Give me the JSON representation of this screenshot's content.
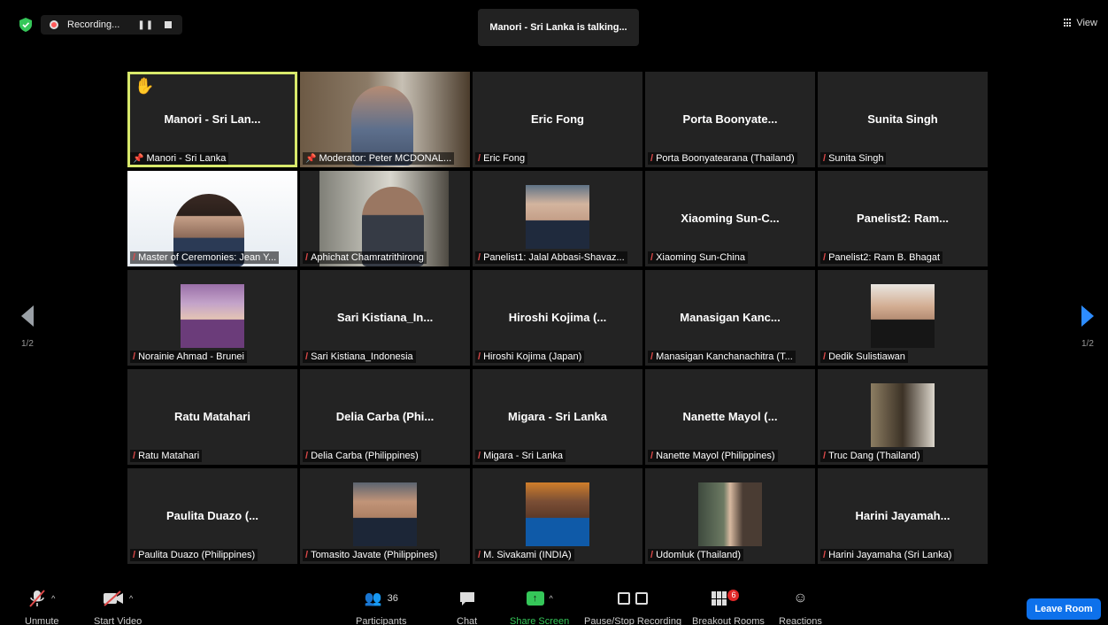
{
  "top": {
    "recording_label": "Recording...",
    "talking_banner": "Manori - Sri Lanka is talking...",
    "view_label": "View"
  },
  "nav": {
    "prev_page": "1/2",
    "next_page": "1/2"
  },
  "tiles": [
    {
      "big": "Manori - Sri Lan...",
      "label": "Manori - Sri Lanka",
      "icon": "pin-icon",
      "hand": "✋"
    },
    {
      "big": "",
      "label": "Moderator: Peter MCDONAL...",
      "icon": "pin-icon"
    },
    {
      "big": "Eric Fong",
      "label": "Eric Fong",
      "icon": "mic-muted-icon"
    },
    {
      "big": "Porta Boonyate...",
      "label": "Porta Boonyatearana (Thailand)",
      "icon": "mic-muted-icon"
    },
    {
      "big": "Sunita Singh",
      "label": "Sunita Singh",
      "icon": "mic-muted-icon"
    },
    {
      "big": "",
      "label": "Master of Ceremonies: Jean Y...",
      "icon": "mic-muted-icon"
    },
    {
      "big": "",
      "label": "Aphichat Chamratrithirong",
      "icon": "mic-muted-icon"
    },
    {
      "big": "",
      "label": "Panelist1: Jalal Abbasi-Shavaz...",
      "icon": "mic-muted-icon"
    },
    {
      "big": "Xiaoming Sun-C...",
      "label": "Xiaoming Sun-China",
      "icon": "mic-muted-icon"
    },
    {
      "big": "Panelist2: Ram...",
      "label": "Panelist2: Ram B. Bhagat",
      "icon": "mic-muted-icon"
    },
    {
      "big": "",
      "label": "Norainie Ahmad - Brunei",
      "icon": "mic-muted-icon"
    },
    {
      "big": "Sari Kistiana_In...",
      "label": "Sari Kistiana_Indonesia",
      "icon": "mic-muted-icon"
    },
    {
      "big": "Hiroshi Kojima (...",
      "label": "Hiroshi Kojima (Japan)",
      "icon": "mic-muted-icon"
    },
    {
      "big": "Manasigan Kanc...",
      "label": "Manasigan Kanchanachitra (T...",
      "icon": "mic-muted-icon"
    },
    {
      "big": "",
      "label": "Dedik Sulistiawan",
      "icon": "mic-muted-icon"
    },
    {
      "big": "Ratu Matahari",
      "label": "Ratu Matahari",
      "icon": "mic-muted-icon"
    },
    {
      "big": "Delia Carba (Phi...",
      "label": "Delia Carba (Philippines)",
      "icon": "mic-muted-icon"
    },
    {
      "big": "Migara - Sri Lanka",
      "label": "Migara - Sri Lanka",
      "icon": "mic-muted-icon"
    },
    {
      "big": "Nanette Mayol (...",
      "label": "Nanette Mayol (Philippines)",
      "icon": "mic-muted-icon"
    },
    {
      "big": "",
      "label": "Truc Dang (Thailand)",
      "icon": "mic-muted-icon"
    },
    {
      "big": "Paulita Duazo (...",
      "label": "Paulita Duazo (Philippines)",
      "icon": "mic-muted-icon"
    },
    {
      "big": "",
      "label": "Tomasito Javate (Philippines)",
      "icon": "mic-muted-icon"
    },
    {
      "big": "",
      "label": "M. Sivakami (INDIA)",
      "icon": "mic-muted-icon"
    },
    {
      "big": "",
      "label": "Udomluk (Thailand)",
      "icon": "mic-muted-icon"
    },
    {
      "big": "Harini Jayamah...",
      "label": "Harini Jayamaha (Sri Lanka)",
      "icon": "mic-muted-icon"
    }
  ],
  "toolbar": {
    "unmute": "Unmute",
    "start_video": "Start Video",
    "participants": "Participants",
    "participants_count": "36",
    "chat": "Chat",
    "share_screen": "Share Screen",
    "pause_stop": "Pause/Stop Recording",
    "breakout": "Breakout Rooms",
    "breakout_badge": "6",
    "reactions": "Reactions",
    "leave": "Leave Room"
  },
  "colors": {
    "active_speaker": "#d8e96b",
    "share_green": "#35c759",
    "leave_blue": "#0e71eb",
    "muted_red": "#e04a4a"
  }
}
